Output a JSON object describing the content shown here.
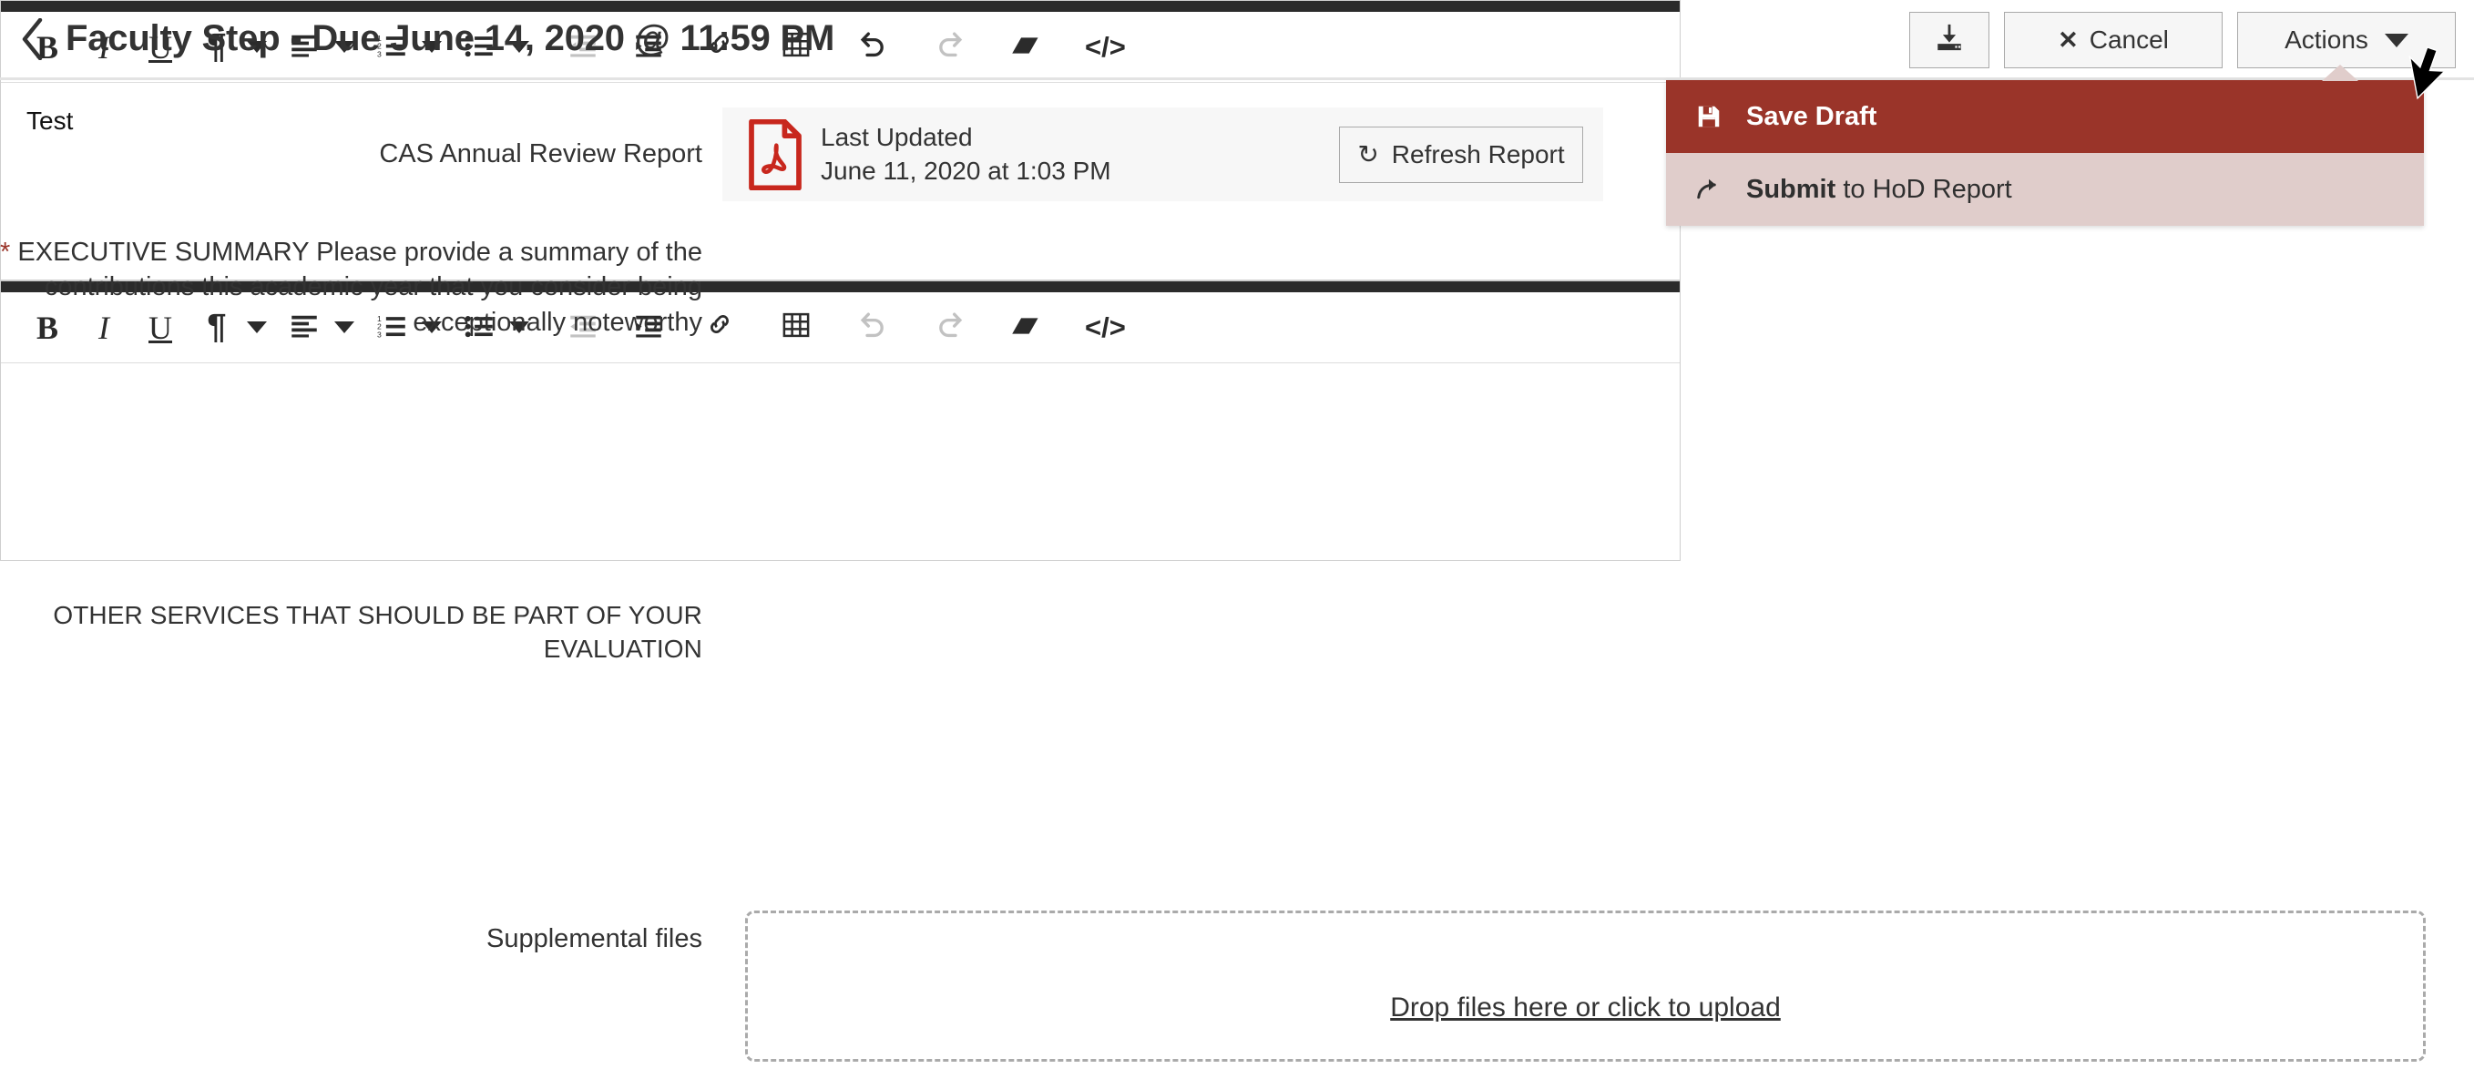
{
  "header": {
    "back_icon": "chevron-left-icon",
    "title": "Faculty Step - Due June 14, 2020 @ 11:59 PM",
    "download_icon": "download-icon",
    "cancel_label": "Cancel",
    "cancel_icon": "close-x-icon",
    "actions_label": "Actions",
    "actions_caret_icon": "caret-down-icon"
  },
  "actions_menu": {
    "items": [
      {
        "icon": "save-floppy-icon",
        "label_bold": "Save Draft",
        "label_rest": "",
        "state": "highlighted"
      },
      {
        "icon": "share-arrow-icon",
        "label_bold": "Submit",
        "label_rest": " to HoD Report",
        "state": "normal"
      }
    ],
    "highlight_color": "#9a3429",
    "normal_color": "#e0cdcb"
  },
  "report": {
    "label": "CAS Annual Review Report",
    "pdf_icon": "pdf-file-icon",
    "last_updated_label": "Last Updated",
    "last_updated_value": "June 11, 2020 at 1:03 PM",
    "refresh_label": "Refresh Report",
    "refresh_icon": "refresh-icon",
    "pdf_icon_color": "#c8271d"
  },
  "fields": [
    {
      "required": true,
      "required_marker": "*",
      "label": "EXECUTIVE SUMMARY Please provide a summary of the contributions this academic year that you consider being exceptionally noteworthy",
      "content": "Test",
      "undo_enabled": true,
      "redo_enabled": false
    },
    {
      "required": false,
      "required_marker": "",
      "label": "OTHER SERVICES THAT SHOULD BE PART OF YOUR EVALUATION",
      "content": "",
      "undo_enabled": false,
      "redo_enabled": false
    }
  ],
  "toolbar": {
    "bold": "B",
    "italic": "I",
    "underline": "U",
    "paragraph": "¶",
    "align_icon": "align-left-icon",
    "ordered_list_icon": "ordered-list-icon",
    "unordered_list_icon": "unordered-list-icon",
    "outdent_icon": "outdent-icon",
    "indent_icon": "indent-icon",
    "link_icon": "link-icon",
    "table_icon": "table-icon",
    "undo_icon": "undo-icon",
    "redo_icon": "redo-icon",
    "eraser_icon": "eraser-icon",
    "code_icon": "code-view-icon"
  },
  "upload": {
    "label": "Supplemental files",
    "dropzone_text": "Drop files here or click to upload"
  }
}
